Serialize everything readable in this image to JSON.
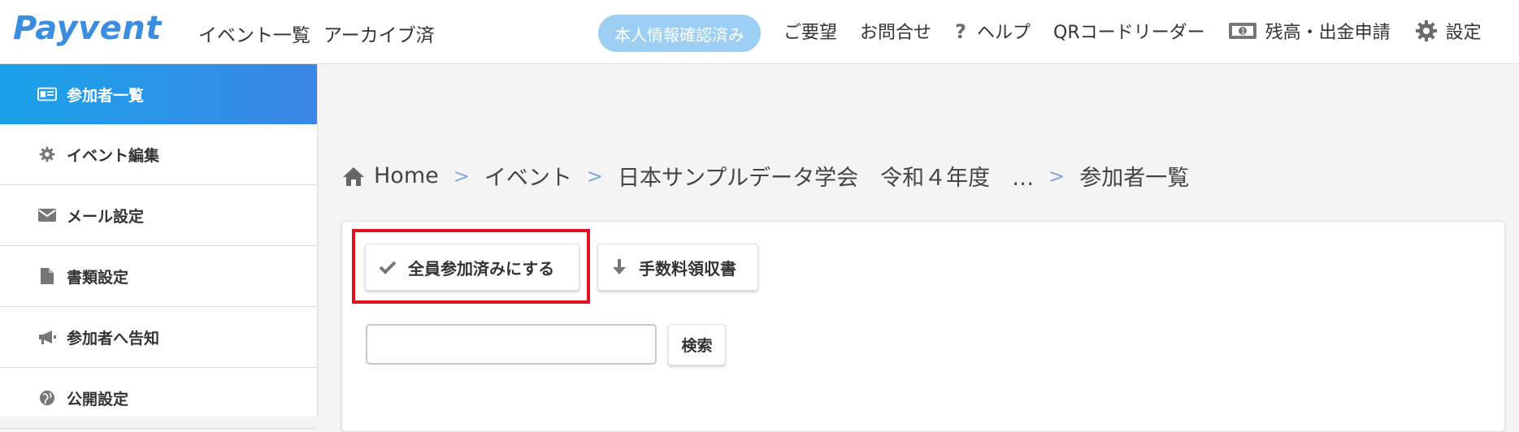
{
  "header": {
    "logo": "Payvent",
    "nav_left": [
      "イベント一覧",
      "アーカイブ済"
    ],
    "verified_badge": "本人情報確認済み",
    "nav_right": [
      {
        "label": "ご要望",
        "icon": ""
      },
      {
        "label": "お問合せ",
        "icon": ""
      },
      {
        "label": "ヘルプ",
        "icon": "question-icon"
      },
      {
        "label": "QRコードリーダー",
        "icon": ""
      },
      {
        "label": "残高・出金申請",
        "icon": "money-icon"
      },
      {
        "label": "設定",
        "icon": "gear-icon"
      }
    ]
  },
  "sidebar": {
    "items": [
      {
        "label": "参加者一覧",
        "icon": "id-card-icon",
        "active": true
      },
      {
        "label": "イベント編集",
        "icon": "gear-icon"
      },
      {
        "label": "メール設定",
        "icon": "envelope-icon"
      },
      {
        "label": "書類設定",
        "icon": "document-icon"
      },
      {
        "label": "参加者へ告知",
        "icon": "megaphone-icon"
      },
      {
        "label": "公開設定",
        "icon": "globe-icon"
      }
    ]
  },
  "breadcrumb": {
    "items": [
      "Home",
      "イベント",
      "日本サンプルデータ学会　令和４年度　…",
      "参加者一覧"
    ]
  },
  "actions": {
    "mark_all_attended": "全員参加済みにする",
    "fee_receipt": "手数料領収書"
  },
  "search": {
    "value": "",
    "placeholder": "",
    "button": "検索"
  },
  "colors": {
    "accent": "#3a8de0",
    "sidebar_active_start": "#1aa3e8",
    "sidebar_active_end": "#3a86e6",
    "badge_bg": "#9dcff4",
    "highlight": "#e0101c"
  }
}
